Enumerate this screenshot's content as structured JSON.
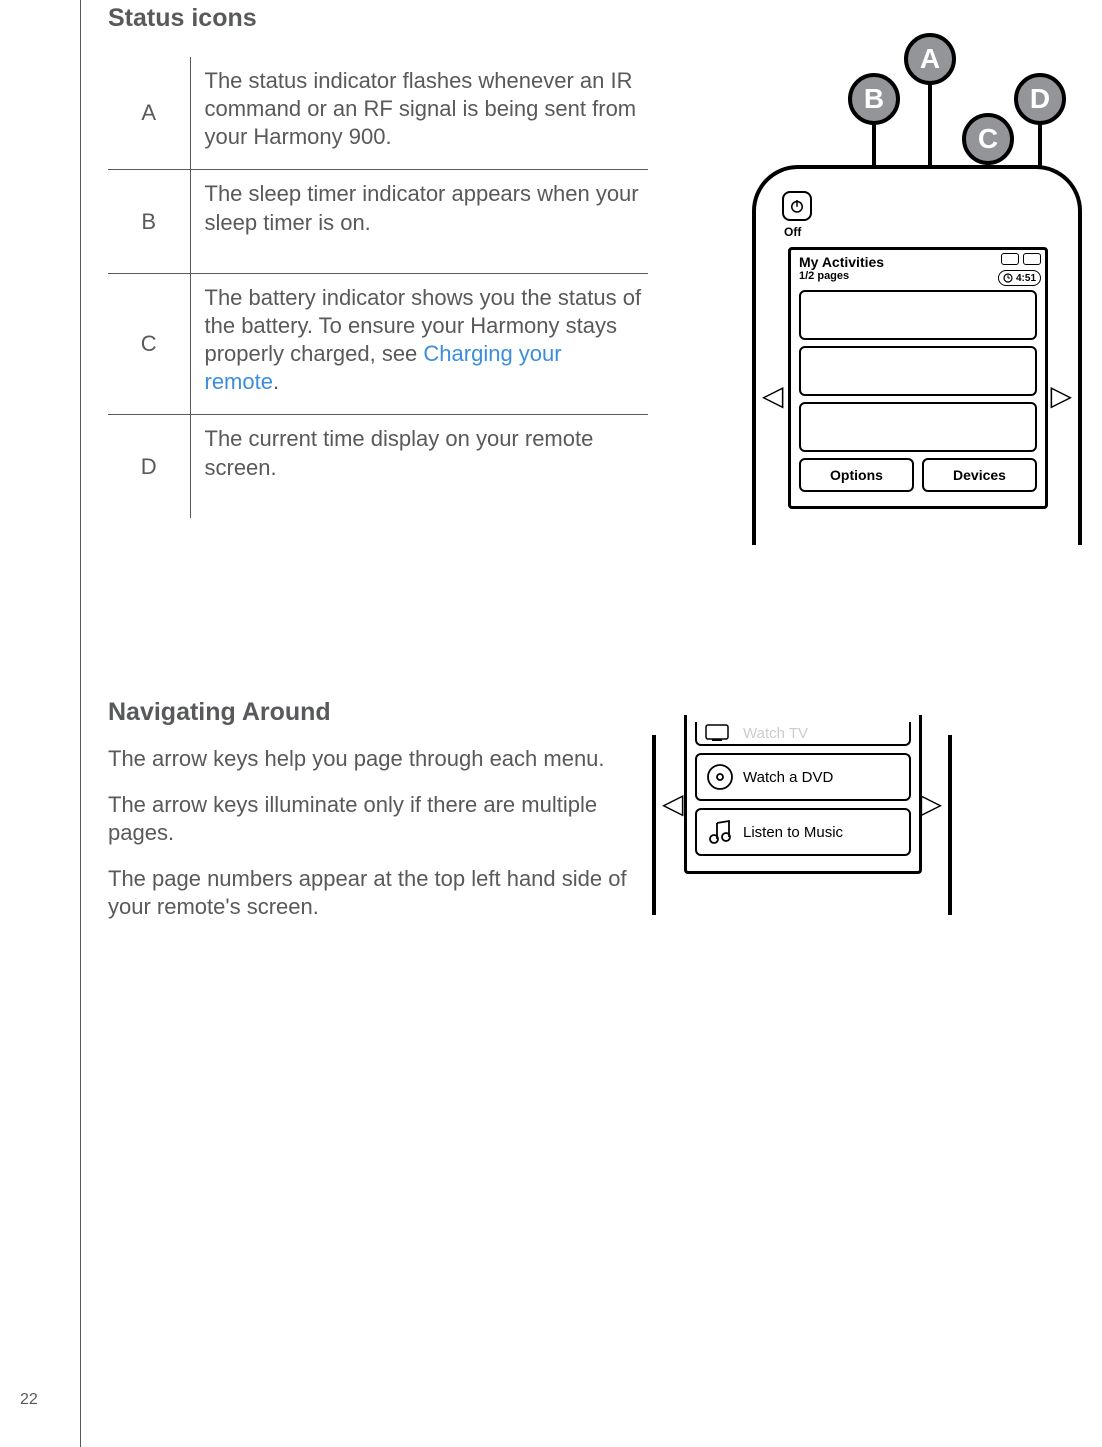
{
  "page_number": "22",
  "headings": {
    "status_icons": "Status icons",
    "navigating": "Navigating Around"
  },
  "table": {
    "rows": [
      {
        "letter": "A",
        "desc": "The status indicator flashes whenever an IR command or an RF signal is being sent from your Harmony 900."
      },
      {
        "letter": "B",
        "desc": "The sleep timer indicator appears when your sleep timer is on."
      },
      {
        "letter": "C",
        "desc_pre": "The battery indicator shows you the status of the battery.  To ensure your Harmony stays properly charged, see ",
        "link": "Charging your remote",
        "desc_post": "."
      },
      {
        "letter": "D",
        "desc": "The current time display on your remote screen."
      }
    ]
  },
  "navigating": {
    "p1": "The arrow keys help you page through each menu.",
    "p2": "The arrow keys illuminate only if there are multiple pages.",
    "p3": "The page numbers appear at the top left hand side of your remote's screen."
  },
  "remote": {
    "off": "Off",
    "my_activities": "My Activities",
    "pages": "1/2 pages",
    "time": "4:51",
    "options": "Options",
    "devices": "Devices",
    "callouts": {
      "A": "A",
      "B": "B",
      "C": "C",
      "D": "D"
    }
  },
  "remote2": {
    "watch_tv": "Watch TV",
    "watch_dvd": "Watch a DVD",
    "listen_music": "Listen to Music"
  }
}
